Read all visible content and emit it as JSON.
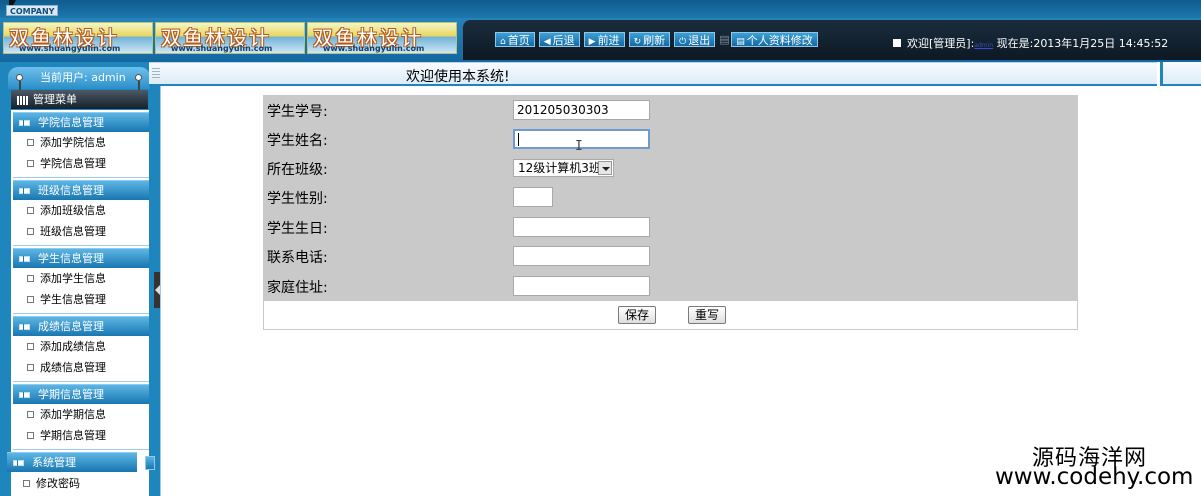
{
  "header": {
    "company": "COMPANY",
    "logos": [
      {
        "text": "双鱼林设计",
        "url": "www.shuangyulin.com"
      },
      {
        "text": "双鱼林设计",
        "url": "www.shuangyulin.com"
      },
      {
        "text": "双鱼林设计",
        "url": "www.shuangyulin.com"
      }
    ],
    "nav": [
      {
        "label": "首页",
        "icon": "home-icon",
        "glyph": "⌂"
      },
      {
        "label": "后退",
        "icon": "arrow-left-icon",
        "glyph": "◀"
      },
      {
        "label": "前进",
        "icon": "arrow-right-icon",
        "glyph": "▶"
      },
      {
        "label": "刷新",
        "icon": "refresh-icon",
        "glyph": "↻"
      },
      {
        "label": "退出",
        "icon": "power-icon",
        "glyph": "⏻"
      },
      {
        "label": "个人资料修改",
        "icon": "profile-icon",
        "glyph": "▤"
      }
    ],
    "welcome_prefix": "欢迎[管理员]:",
    "welcome_user": "admin",
    "now_label": "现在是:2013年1月25日 14:45:52"
  },
  "sidebar": {
    "current_user": "当前用户: admin",
    "menu_title": "管理菜单",
    "groups": [
      {
        "title": "学院信息管理",
        "items": [
          "添加学院信息",
          "学院信息管理"
        ]
      },
      {
        "title": "班级信息管理",
        "items": [
          "添加班级信息",
          "班级信息管理"
        ]
      },
      {
        "title": "学生信息管理",
        "items": [
          "添加学生信息",
          "学生信息管理"
        ]
      },
      {
        "title": "成绩信息管理",
        "items": [
          "添加成绩信息",
          "成绩信息管理"
        ]
      },
      {
        "title": "学期信息管理",
        "items": [
          "添加学期信息",
          "学期信息管理"
        ]
      },
      {
        "title": "系统管理",
        "items": [
          "修改密码"
        ]
      }
    ]
  },
  "main": {
    "title": "欢迎使用本系统!",
    "form": {
      "fields": [
        {
          "label": "学生学号:",
          "value": "201205030303",
          "type": "text"
        },
        {
          "label": "学生姓名:",
          "value": "",
          "type": "text"
        },
        {
          "label": "所在班级:",
          "value": "12级计算机3班",
          "type": "select"
        },
        {
          "label": "学生性别:",
          "value": "",
          "type": "text"
        },
        {
          "label": "学生生日:",
          "value": "",
          "type": "text"
        },
        {
          "label": "联系电话:",
          "value": "",
          "type": "text"
        },
        {
          "label": "家庭住址:",
          "value": "",
          "type": "text"
        }
      ],
      "save_label": "保存",
      "reset_label": "重写"
    }
  },
  "watermark": {
    "line1": "源码海洋网",
    "line2": "www.codehy.com"
  }
}
